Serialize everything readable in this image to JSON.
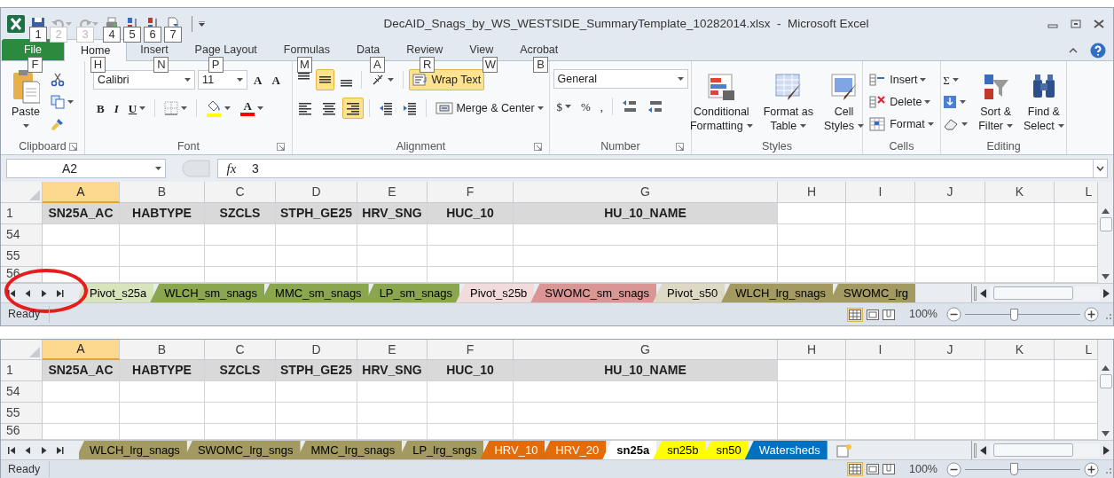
{
  "window": {
    "title": "DecAID_Snags_by_WS_WESTSIDE_SummaryTemplate_10282014.xlsx  -  Microsoft Excel"
  },
  "quick_access": [
    {
      "keytip": "1",
      "disabled": false
    },
    {
      "keytip": "2",
      "disabled": true
    },
    {
      "keytip": "3",
      "disabled": true
    },
    {
      "keytip": "4",
      "disabled": false
    },
    {
      "keytip": "5",
      "disabled": false
    },
    {
      "keytip": "6",
      "disabled": false
    },
    {
      "keytip": "7",
      "disabled": false
    }
  ],
  "ribbon_tabs": [
    {
      "label": "File",
      "keytip": "F",
      "kind": "file",
      "selected": false
    },
    {
      "label": "Home",
      "keytip": "H",
      "kind": "tab",
      "selected": true
    },
    {
      "label": "Insert",
      "keytip": "N",
      "kind": "tab",
      "selected": false
    },
    {
      "label": "Page Layout",
      "keytip": "P",
      "kind": "tab",
      "selected": false
    },
    {
      "label": "Formulas",
      "keytip": "M",
      "kind": "tab",
      "selected": false
    },
    {
      "label": "Data",
      "keytip": "A",
      "kind": "tab",
      "selected": false
    },
    {
      "label": "Review",
      "keytip": "R",
      "kind": "tab",
      "selected": false
    },
    {
      "label": "View",
      "keytip": "W",
      "kind": "tab",
      "selected": false
    },
    {
      "label": "Acrobat",
      "keytip": "B",
      "kind": "tab",
      "selected": false
    }
  ],
  "ribbon_groups": [
    {
      "label": "Clipboard",
      "launcher": true,
      "parts": [
        {
          "kind": "large",
          "lines": [
            "Paste"
          ],
          "dropdown": true
        },
        {
          "kind": "stack",
          "lines": [
            [
              {
                "kind": "icon"
              }
            ],
            [
              {
                "kind": "icon",
                "dropdown": true
              }
            ],
            [
              {
                "kind": "icon"
              }
            ]
          ]
        }
      ]
    },
    {
      "label": "Font",
      "launcher": true,
      "parts": [
        {
          "kind": "stack",
          "lines": [
            [
              {
                "kind": "field",
                "value": "Calibri"
              },
              {
                "kind": "field",
                "value": "11"
              },
              {
                "kind": "glyph",
                "text": "A"
              },
              {
                "kind": "glyph",
                "text": "A"
              }
            ],
            [
              {
                "kind": "glyph",
                "text": "B"
              },
              {
                "kind": "glyph",
                "text": "I"
              },
              {
                "kind": "glyph",
                "text": "U",
                "dropdown": true
              },
              {
                "kind": "separator"
              },
              {
                "kind": "icon",
                "dropdown": true
              },
              {
                "kind": "separator"
              },
              {
                "kind": "icon",
                "dropdown": true,
                "color": "#ffff00"
              },
              {
                "kind": "glyph",
                "text": "A",
                "dropdown": true,
                "color": "#ff0000"
              }
            ]
          ]
        }
      ]
    },
    {
      "label": "Alignment",
      "launcher": true,
      "parts": [
        {
          "kind": "stack",
          "lines": [
            [
              {
                "kind": "icon",
                "selected": false
              },
              {
                "kind": "icon",
                "selected": true
              },
              {
                "kind": "icon",
                "selected": false
              },
              {
                "kind": "separator"
              },
              {
                "kind": "icon",
                "dropdown": true
              },
              {
                "kind": "separator"
              },
              {
                "kind": "button",
                "label": "Wrap Text",
                "selected": true
              }
            ],
            [
              {
                "kind": "icon",
                "selected": false
              },
              {
                "kind": "icon",
                "selected": false
              },
              {
                "kind": "icon",
                "selected": true
              },
              {
                "kind": "separator"
              },
              {
                "kind": "icon"
              },
              {
                "kind": "icon"
              },
              {
                "kind": "separator"
              },
              {
                "kind": "button",
                "label": "Merge & Center",
                "dropdown": true,
                "selected": false
              }
            ]
          ]
        }
      ]
    },
    {
      "label": "Number",
      "launcher": true,
      "parts": [
        {
          "kind": "stack",
          "lines": [
            [
              {
                "kind": "field",
                "value": "General"
              }
            ],
            [
              {
                "kind": "glyph",
                "text": "$",
                "dropdown": true
              },
              {
                "kind": "glyph",
                "text": "%"
              },
              {
                "kind": "glyph",
                "text": ","
              },
              {
                "kind": "separator"
              },
              {
                "kind": "icon"
              },
              {
                "kind": "icon"
              }
            ]
          ]
        }
      ]
    },
    {
      "label": "Styles",
      "parts": [
        {
          "kind": "large",
          "lines": [
            "Conditional",
            "Formatting"
          ],
          "dropdown": true
        },
        {
          "kind": "large",
          "lines": [
            "Format as",
            "Table"
          ],
          "dropdown": true
        },
        {
          "kind": "large",
          "lines": [
            "Cell",
            "Styles"
          ],
          "dropdown": true
        }
      ]
    },
    {
      "label": "Cells",
      "parts": [
        {
          "kind": "stack",
          "lines": [
            [
              {
                "kind": "small",
                "label": "Insert",
                "dropdown": true
              }
            ],
            [
              {
                "kind": "small",
                "label": "Delete",
                "dropdown": true
              }
            ],
            [
              {
                "kind": "small",
                "label": "Format",
                "dropdown": true
              }
            ]
          ]
        }
      ]
    },
    {
      "label": "Editing",
      "parts": [
        {
          "kind": "stack",
          "lines": [
            [
              {
                "kind": "glyph",
                "text": "Σ",
                "dropdown": true
              }
            ],
            [
              {
                "kind": "icon",
                "dropdown": true
              }
            ],
            [
              {
                "kind": "icon",
                "dropdown": true
              }
            ]
          ]
        },
        {
          "kind": "large",
          "lines": [
            "Sort &",
            "Filter"
          ],
          "dropdown": true
        },
        {
          "kind": "large",
          "lines": [
            "Find &",
            "Select"
          ],
          "dropdown": true
        }
      ]
    }
  ],
  "formula_bar": {
    "name_box": "A2",
    "fx": "fx",
    "value": "3"
  },
  "sheet_views": [
    {
      "columns": [
        {
          "label": "A",
          "selected": true
        },
        {
          "label": "B",
          "selected": false
        },
        {
          "label": "C",
          "selected": false
        },
        {
          "label": "D",
          "selected": false
        },
        {
          "label": "E",
          "selected": false
        },
        {
          "label": "F",
          "selected": false
        },
        {
          "label": "G",
          "selected": false
        },
        {
          "label": "H",
          "selected": false
        },
        {
          "label": "I",
          "selected": false
        },
        {
          "label": "J",
          "selected": false
        },
        {
          "label": "K",
          "selected": false
        },
        {
          "label": "L",
          "selected": false
        }
      ],
      "header_row": {
        "label": "1",
        "cells": [
          "SN25A_AC",
          "HABTYPE",
          "SZCLS",
          "STPH_GE25",
          "HRV_SNG",
          "HUC_10",
          "HU_10_NAME"
        ]
      },
      "rows": [
        "54",
        "55",
        "56"
      ],
      "tabs": [
        {
          "label": "Pivot_s25a",
          "color": "#d8e4bc",
          "selected": false
        },
        {
          "label": "WLCH_sm_snags",
          "color": "#8aa64e",
          "selected": false
        },
        {
          "label": "MMC_sm_snags",
          "color": "#8aa64e",
          "selected": false
        },
        {
          "label": "LP_sm_snags",
          "color": "#8aa64e",
          "selected": false
        },
        {
          "label": "Pivot_s25b",
          "color": "#f2dcdb",
          "selected": false
        },
        {
          "label": "SWOMC_sm_snags",
          "color": "#da9694",
          "selected": false
        },
        {
          "label": "Pivot_s50",
          "color": "#ddd9c4",
          "selected": false
        },
        {
          "label": "WLCH_lrg_snags",
          "color": "#a39a62",
          "selected": false
        },
        {
          "label": "SWOMC_lrg",
          "color": "#a39a62",
          "selected": false
        }
      ],
      "status": "Ready",
      "zoom": {
        "reading": "100%",
        "level": 0.42
      },
      "annotated": true
    },
    {
      "columns": [
        {
          "label": "A",
          "selected": true
        },
        {
          "label": "B",
          "selected": false
        },
        {
          "label": "C",
          "selected": false
        },
        {
          "label": "D",
          "selected": false
        },
        {
          "label": "E",
          "selected": false
        },
        {
          "label": "F",
          "selected": false
        },
        {
          "label": "G",
          "selected": false
        },
        {
          "label": "H",
          "selected": false
        },
        {
          "label": "I",
          "selected": false
        },
        {
          "label": "J",
          "selected": false
        },
        {
          "label": "K",
          "selected": false
        },
        {
          "label": "L",
          "selected": false
        }
      ],
      "header_row": {
        "label": "1",
        "cells": [
          "SN25A_AC",
          "HABTYPE",
          "SZCLS",
          "STPH_GE25",
          "HRV_SNG",
          "HUC_10",
          "HU_10_NAME"
        ]
      },
      "rows": [
        "54",
        "55",
        "56"
      ],
      "tabs": [
        {
          "label": "WLCH_lrg_snags",
          "color": "#a39a62",
          "selected": false
        },
        {
          "label": "SWOMC_lrg_sngs",
          "color": "#a39a62",
          "selected": false
        },
        {
          "label": "MMC_lrg_snags",
          "color": "#a39a62",
          "selected": false
        },
        {
          "label": "LP_lrg_sngs",
          "color": "#a39a62",
          "selected": false
        },
        {
          "label": "HRV_10",
          "color": "#e26b0a",
          "selected": false
        },
        {
          "label": "HRV_20",
          "color": "#e26b0a",
          "selected": false
        },
        {
          "label": "sn25a",
          "color": "#ffffff",
          "selected": true
        },
        {
          "label": "sn25b",
          "color": "#ffff00",
          "selected": false
        },
        {
          "label": "sn50",
          "color": "#ffff00",
          "selected": false
        },
        {
          "label": "Watersheds",
          "color": "#0070c0",
          "selected": false
        }
      ],
      "new_sheet_tab": true,
      "status": "Ready",
      "zoom": {
        "reading": "100%",
        "level": 0.42
      }
    }
  ]
}
